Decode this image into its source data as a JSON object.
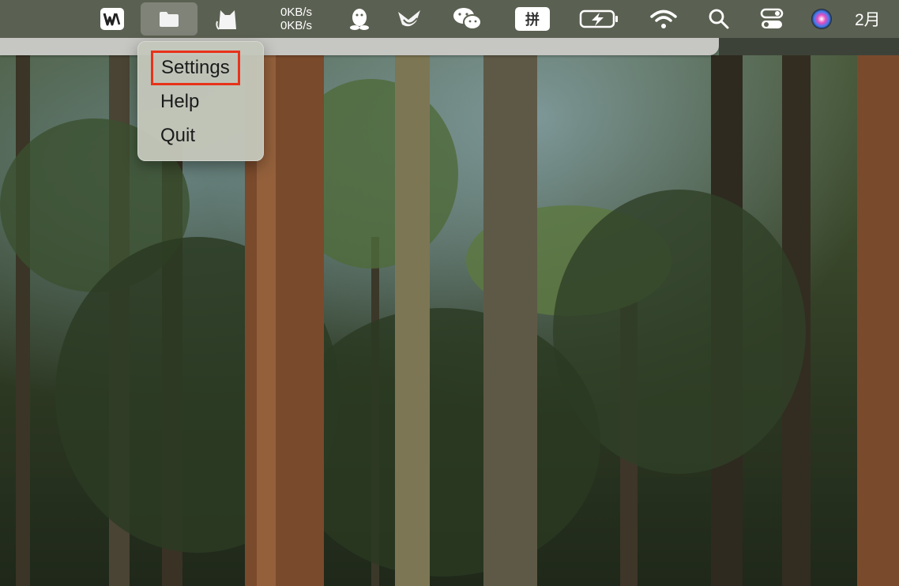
{
  "menubar": {
    "items": [
      {
        "name": "wps-office-icon"
      },
      {
        "name": "folder-icon",
        "active": true
      },
      {
        "name": "cat-app-icon"
      },
      {
        "name": "qq-penguin-icon"
      },
      {
        "name": "bird-app-icon"
      },
      {
        "name": "wechat-icon"
      },
      {
        "name": "input-method-icon",
        "label": "拼"
      },
      {
        "name": "battery-charging-icon"
      },
      {
        "name": "wifi-icon"
      },
      {
        "name": "search-icon"
      },
      {
        "name": "control-center-icon"
      },
      {
        "name": "siri-icon"
      }
    ],
    "net_up": "0KB/s",
    "net_down": "0KB/s",
    "clock": "2月"
  },
  "dropdown": {
    "items": [
      {
        "label": "Settings",
        "highlighted": true
      },
      {
        "label": "Help"
      },
      {
        "label": "Quit"
      }
    ]
  },
  "colors": {
    "menubar": "#5b6152",
    "dropdown_bg": "#c4c7ba",
    "highlight_border": "#e8321a"
  }
}
